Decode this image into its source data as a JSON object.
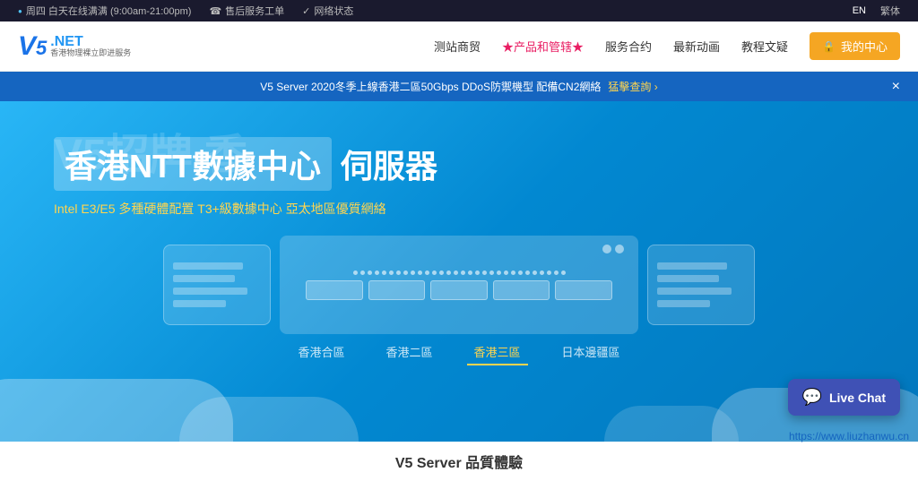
{
  "topbar": {
    "items": [
      {
        "icon": "wifi-icon",
        "text": "周四 白天在线满满 (9:00am-21:00pm)"
      },
      {
        "icon": "phone-icon",
        "text": "售后服务工单"
      },
      {
        "icon": "check-icon",
        "text": "网络状态"
      }
    ],
    "lang": {
      "current": "EN",
      "separator": "繁体"
    }
  },
  "header": {
    "logo_v5": "V5",
    "logo_net": ".NET",
    "logo_sub": "香港物理裸立即进服务",
    "nav_items": [
      {
        "label": "测站商贸",
        "highlight": false
      },
      {
        "label": "★产品和管辖★",
        "highlight": true
      },
      {
        "label": "服务合约",
        "highlight": false
      },
      {
        "label": "最新动画",
        "highlight": false
      },
      {
        "label": "教程文疑",
        "highlight": false
      }
    ],
    "account_btn": "我的中心"
  },
  "announcement": {
    "text": "V5 Server 2020冬季上線香港二區50Gbps DDoS防禦機型 配備CN2網絡",
    "link_text": "猛擊查詢 ›",
    "close_label": "×"
  },
  "hero": {
    "bg_text": "V5招牌  香",
    "title_box": "香港NTT數據中心",
    "title_text": "伺服器",
    "subtitle": "Intel E3/E5 多種硬體配置 T3+級數據中心",
    "subtitle_link": "亞太地區優質網絡"
  },
  "tabs": [
    {
      "label": "香港合區",
      "active": false
    },
    {
      "label": "香港二區",
      "active": false
    },
    {
      "label": "香港三區",
      "active": true
    },
    {
      "label": "日本邊疆區",
      "active": false
    }
  ],
  "livechat": {
    "label": "Live Chat"
  },
  "footer": {
    "link": "https://www.liuzhanwu.cn",
    "section_title": "V5 Server 品質體驗"
  }
}
